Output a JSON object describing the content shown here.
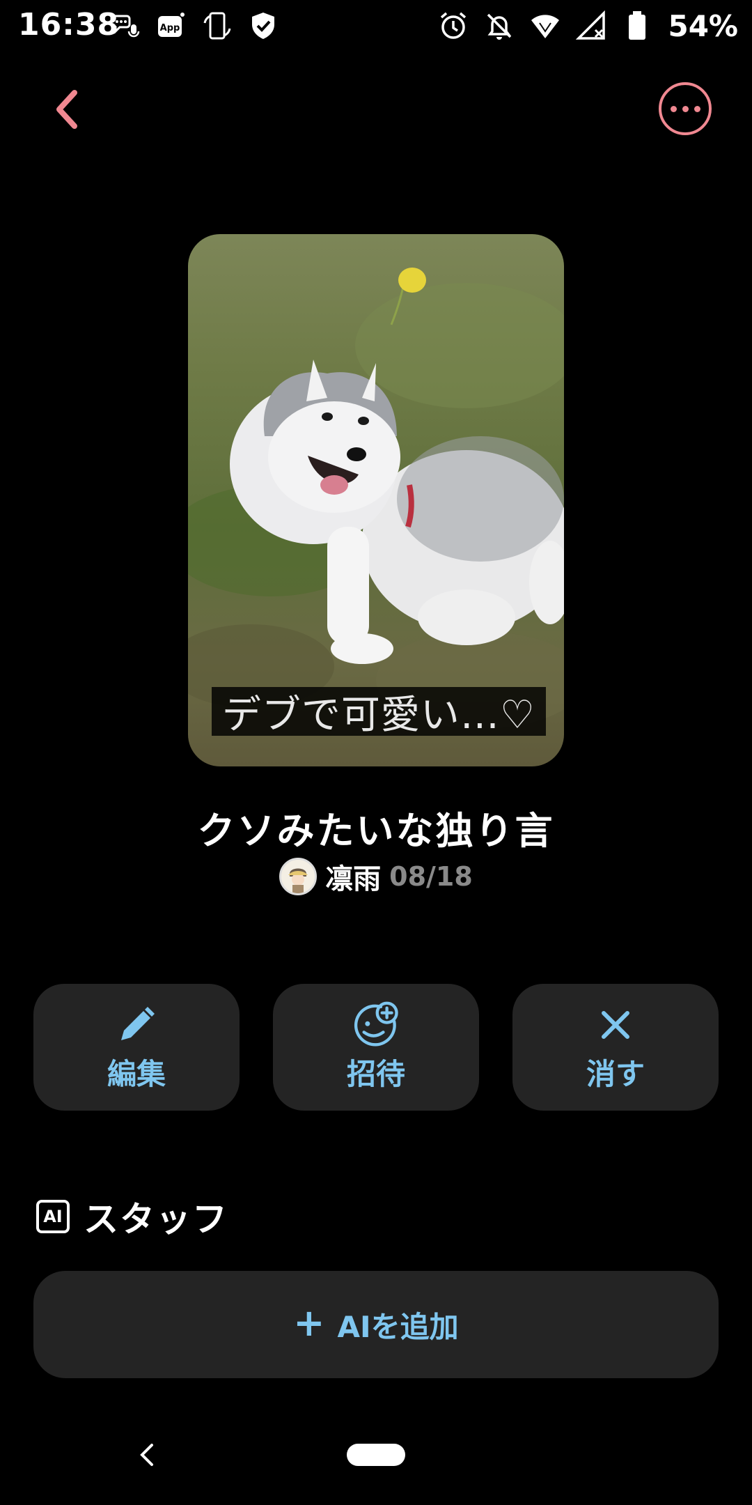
{
  "status_bar": {
    "time": "16:38",
    "left_icons": [
      "chat-mic-icon",
      "app-notification-icon",
      "screen-rotate-icon",
      "shield-check-icon"
    ],
    "right_icons": [
      "alarm-icon",
      "notifications-off-icon",
      "wifi-icon",
      "signal-off-icon",
      "battery-icon"
    ],
    "battery": "54%"
  },
  "top_bar": {
    "back_icon": "chevron-left-icon",
    "more_icon": "more-options-icon",
    "accent_color": "#f08891"
  },
  "cover": {
    "caption": "デブで可愛い…♡"
  },
  "post": {
    "title": "クソみたいな独り言",
    "author": "凛雨",
    "date": "08/18"
  },
  "actions": [
    {
      "label": "編集",
      "icon": "pencil-icon"
    },
    {
      "label": "招待",
      "icon": "add-person-icon"
    },
    {
      "label": "消す",
      "icon": "close-icon"
    }
  ],
  "staff": {
    "badge": "AI",
    "title": "スタッフ",
    "add_button": "AIを追加",
    "add_icon": "plus-icon"
  },
  "colors": {
    "action_text": "#7fc6ef",
    "button_bg": "#242424",
    "background": "#000000"
  }
}
